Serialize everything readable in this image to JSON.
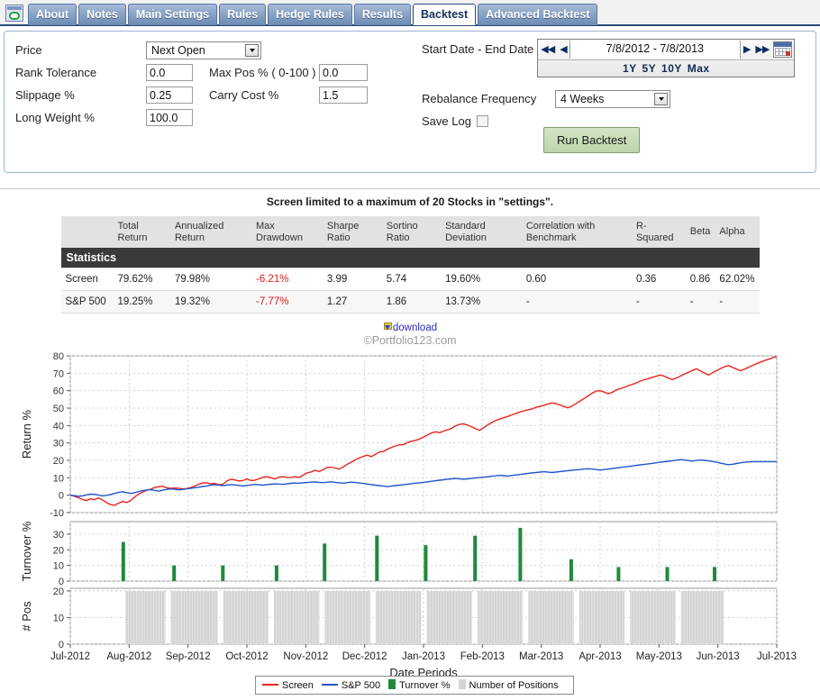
{
  "tabs": [
    {
      "label": "About",
      "active": false
    },
    {
      "label": "Notes",
      "active": false
    },
    {
      "label": "Main Settings",
      "active": false
    },
    {
      "label": "Rules",
      "active": false
    },
    {
      "label": "Hedge Rules",
      "active": false
    },
    {
      "label": "Results",
      "active": false
    },
    {
      "label": "Backtest",
      "active": true
    },
    {
      "label": "Advanced Backtest",
      "active": false
    }
  ],
  "settings": {
    "price_label": "Price",
    "price_value": "Next Open",
    "rank_tolerance_label": "Rank Tolerance",
    "rank_tolerance_value": "0.0",
    "max_pos_label": "Max Pos % ( 0-100 )",
    "max_pos_value": "0.0",
    "slippage_label": "Slippage %",
    "slippage_value": "0.25",
    "carry_cost_label": "Carry Cost %",
    "carry_cost_value": "1.5",
    "long_weight_label": "Long Weight %",
    "long_weight_value": "100.0",
    "date_label": "Start Date - End Date",
    "date_value": "7/8/2012 - 7/8/2013",
    "quick_1y": "1Y",
    "quick_5y": "5Y",
    "quick_10y": "10Y",
    "quick_max": "Max",
    "rebalance_label": "Rebalance Frequency",
    "rebalance_value": "4 Weeks",
    "save_log_label": "Save Log",
    "run_label": "Run Backtest"
  },
  "notice": "Screen limited to a maximum of 20 Stocks in \"settings\".",
  "stats": {
    "title": "Statistics",
    "columns": [
      "Total Return",
      "Annualized Return",
      "Max Drawdown",
      "Sharpe Ratio",
      "Sortino Ratio",
      "Standard Deviation",
      "Correlation with Benchmark",
      "R-Squared",
      "Beta",
      "Alpha"
    ],
    "rows": [
      {
        "name": "Screen",
        "values": [
          "79.62%",
          "79.98%",
          "-6.21%",
          "3.99",
          "5.74",
          "19.60%",
          "0.60",
          "0.36",
          "0.86",
          "62.02%"
        ]
      },
      {
        "name": "S&P 500",
        "values": [
          "19.25%",
          "19.32%",
          "-7.77%",
          "1.27",
          "1.86",
          "13.73%",
          "-",
          "-",
          "-",
          "-"
        ]
      }
    ]
  },
  "download_label": "download",
  "copyright": "©Portfolio123.com",
  "legend": [
    {
      "label": "Screen",
      "type": "line",
      "color": "#e8251f"
    },
    {
      "label": "S&P 500",
      "type": "line",
      "color": "#2255cc"
    },
    {
      "label": "Turnover %",
      "type": "square",
      "color": "#1f8a3c"
    },
    {
      "label": "Number of Positions",
      "type": "square",
      "color": "#d4d4d4"
    }
  ],
  "chart_data": {
    "type": "line",
    "title": "",
    "xlabel": "Date Periods",
    "panels": [
      {
        "id": "return",
        "ylabel": "Return %",
        "ylim": [
          -10,
          80
        ],
        "yticks": [
          -10,
          0,
          10,
          20,
          30,
          40,
          50,
          60,
          70,
          80
        ],
        "grid": true,
        "series": [
          {
            "name": "Screen",
            "color": "#e8251f",
            "values": [
              0,
              -0.6,
              -1.4,
              -2.4,
              -3.1,
              -2.1,
              -2.6,
              -1.5,
              -2.7,
              -4.2,
              -5.4,
              -5.8,
              -4.6,
              -3.6,
              -4.2,
              -3.2,
              -1.1,
              0.6,
              1.7,
              2.8,
              3.4,
              4.4,
              4.9,
              5.1,
              4.2,
              3.9,
              4.1,
              4.0,
              3.6,
              3.8,
              4.4,
              5.2,
              6.3,
              7.0,
              7.1,
              6.5,
              6.8,
              6.0,
              6.3,
              8.1,
              9.2,
              8.8,
              8.2,
              8.4,
              9.3,
              8.4,
              8.6,
              9.4,
              10.3,
              10.6,
              10.0,
              9.3,
              10.4,
              10.6,
              10.2,
              10.1,
              10.7,
              10.1,
              11.5,
              12.8,
              13.4,
              14.3,
              13.6,
              14.6,
              15.9,
              16.1,
              15.6,
              15.0,
              16.3,
              17.8,
              18.9,
              20.3,
              21.4,
              22.3,
              23.0,
              22.1,
              23.4,
              24.8,
              25.1,
              26.4,
              27.4,
              28.3,
              28.9,
              29.0,
              30.2,
              31.0,
              31.5,
              32.2,
              33.4,
              34.6,
              35.7,
              36.4,
              35.9,
              36.8,
              37.6,
              38.3,
              39.8,
              40.7,
              41.0,
              40.2,
              39.2,
              38.1,
              37.2,
              38.8,
              40.4,
              41.7,
              42.9,
              43.7,
              44.5,
              45.2,
              46.1,
              46.9,
              47.8,
              48.4,
              49.0,
              49.5,
              50.4,
              51.0,
              51.6,
              52.4,
              53.0,
              52.6,
              51.8,
              50.9,
              50.2,
              51.2,
              52.7,
              54.1,
              55.5,
              57.0,
              58.6,
              59.8,
              60.0,
              59.2,
              58.3,
              59.0,
              60.4,
              61.2,
              61.9,
              62.9,
              63.6,
              64.5,
              65.5,
              66.3,
              66.9,
              67.7,
              68.3,
              69.0,
              68.3,
              67.2,
              66.4,
              67.3,
              68.4,
              69.5,
              70.6,
              71.6,
              72.6,
              71.4,
              70.1,
              69.0,
              70.3,
              71.5,
              72.7,
              73.8,
              74.4,
              73.4,
              72.4,
              71.4,
              72.4,
              73.5,
              74.5,
              75.5,
              76.5,
              77.3,
              78.1,
              78.9,
              79.62
            ]
          },
          {
            "name": "S&P 500",
            "color": "#2255cc",
            "values": [
              0,
              -0.3,
              -0.7,
              -0.4,
              0.2,
              0.6,
              0.5,
              0.1,
              -0.4,
              -0.1,
              0.4,
              1.0,
              1.6,
              2.0,
              1.5,
              1.0,
              1.4,
              2.0,
              2.6,
              3.0,
              3.2,
              2.8,
              2.3,
              2.9,
              3.3,
              3.6,
              3.4,
              3.1,
              3.3,
              3.6,
              3.9,
              4.3,
              4.6,
              5.0,
              5.3,
              5.7,
              6.0,
              5.8,
              5.5,
              5.8,
              6.1,
              5.9,
              5.6,
              5.3,
              5.6,
              5.9,
              6.2,
              6.0,
              5.8,
              6.1,
              6.3,
              6.5,
              6.4,
              6.2,
              6.5,
              6.8,
              7.0,
              6.9,
              7.1,
              7.3,
              7.5,
              7.6,
              7.4,
              7.2,
              7.5,
              7.7,
              7.4,
              7.1,
              6.9,
              7.2,
              7.5,
              7.3,
              7.0,
              6.7,
              6.4,
              6.1,
              5.8,
              5.5,
              5.2,
              4.9,
              5.2,
              5.5,
              5.8,
              6.0,
              6.3,
              6.6,
              6.9,
              7.1,
              7.4,
              7.7,
              8.0,
              8.3,
              8.6,
              8.9,
              9.2,
              9.4,
              9.6,
              9.4,
              9.2,
              9.4,
              9.6,
              9.9,
              10.1,
              10.4,
              10.6,
              10.9,
              11.1,
              11.4,
              11.2,
              11.0,
              11.3,
              11.6,
              11.9,
              12.2,
              12.5,
              12.8,
              13.0,
              13.3,
              13.5,
              13.2,
              13.0,
              13.3,
              13.6,
              13.8,
              14.1,
              14.3,
              14.5,
              14.7,
              15.0,
              15.2,
              15.0,
              14.7,
              14.4,
              14.7,
              15.0,
              15.3,
              15.6,
              15.9,
              16.2,
              16.5,
              16.8,
              17.1,
              17.4,
              17.7,
              18.0,
              18.3,
              18.6,
              18.9,
              19.2,
              19.5,
              19.8,
              20.1,
              20.4,
              20.2,
              19.9,
              19.6,
              19.9,
              20.2,
              20.0,
              19.7,
              19.4,
              18.9,
              18.4,
              17.9,
              17.5,
              17.8,
              18.2,
              18.6,
              18.9,
              19.1,
              19.25,
              19.25,
              19.25,
              19.25,
              19.25,
              19.25,
              19.25
            ]
          }
        ]
      },
      {
        "id": "turnover",
        "ylabel": "Turnover %",
        "ylim": [
          0,
          38
        ],
        "yticks": [
          0,
          10,
          20,
          30
        ],
        "grid": true,
        "bars": [
          {
            "x": 0.075,
            "value": 25
          },
          {
            "x": 0.147,
            "value": 10
          },
          {
            "x": 0.216,
            "value": 10
          },
          {
            "x": 0.292,
            "value": 10
          },
          {
            "x": 0.36,
            "value": 24
          },
          {
            "x": 0.434,
            "value": 29
          },
          {
            "x": 0.503,
            "value": 23
          },
          {
            "x": 0.573,
            "value": 29
          },
          {
            "x": 0.637,
            "value": 34
          },
          {
            "x": 0.709,
            "value": 14
          },
          {
            "x": 0.776,
            "value": 9
          },
          {
            "x": 0.845,
            "value": 9
          },
          {
            "x": 0.912,
            "value": 9
          }
        ],
        "color": "#1f8a3c"
      },
      {
        "id": "positions",
        "ylabel": "# Pos",
        "ylim": [
          0,
          21
        ],
        "yticks": [
          0,
          10,
          20
        ],
        "grid": true,
        "value": 20,
        "fill_start": 0.078,
        "fill_end": 0.925,
        "color": "#d4d4d4",
        "gaps": [
          0.1385,
          0.2125,
          0.2845,
          0.3565,
          0.4285,
          0.5005,
          0.5725,
          0.6445,
          0.7165,
          0.7885,
          0.8605
        ]
      }
    ],
    "xticks": [
      "Jul-2012",
      "Aug-2012",
      "Sep-2012",
      "Oct-2012",
      "Nov-2012",
      "Dec-2012",
      "Jan-2013",
      "Feb-2013",
      "Mar-2013",
      "Apr-2013",
      "May-2013",
      "Jun-2013",
      "Jul-2013"
    ]
  }
}
